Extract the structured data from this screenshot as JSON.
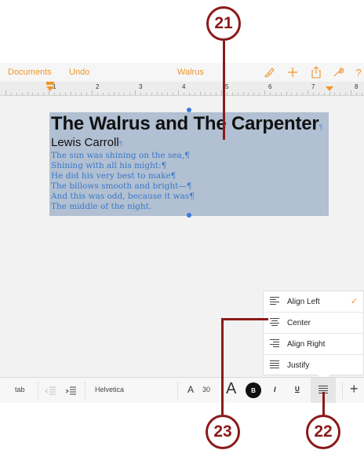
{
  "callouts": {
    "c21": "21",
    "c22": "22",
    "c23": "23"
  },
  "navbar": {
    "documents": "Documents",
    "undo": "Undo",
    "title": "Walrus",
    "icons": [
      "brush-icon",
      "plus-icon",
      "share-icon",
      "wrench-icon",
      "help-icon"
    ]
  },
  "ruler": {
    "numbers": [
      "1",
      "2",
      "3",
      "4",
      "5",
      "6",
      "7",
      "8"
    ]
  },
  "document": {
    "title": "The Walrus and The Carpenter",
    "author": "Lewis Carroll",
    "pilcrow": "¶",
    "poem_lines": [
      "The sun was shining on the sea,¶",
      "Shining with all his might:¶",
      "He did his very best to make¶",
      "The billows smooth and bright—¶",
      "And this was odd, because it was¶",
      "The middle of the night."
    ]
  },
  "alignment_menu": {
    "items": [
      {
        "label": "Align Left",
        "icon": "align-left-icon",
        "selected": true
      },
      {
        "label": "Center",
        "icon": "align-center-icon",
        "selected": false
      },
      {
        "label": "Align Right",
        "icon": "align-right-icon",
        "selected": false
      },
      {
        "label": "Justify",
        "icon": "justify-icon",
        "selected": false
      }
    ],
    "checkmark": "✓"
  },
  "toolbar": {
    "tab": "tab",
    "font": "Helvetica",
    "font_size": "30",
    "small_a": "A",
    "large_a": "A",
    "bold": "B",
    "italic": "I",
    "underline": "U",
    "add": "+"
  },
  "colors": {
    "accent": "#f0952a",
    "selection": "#b1c0d2",
    "callout": "#8b1a1a",
    "poem_text": "#3a78c8"
  }
}
